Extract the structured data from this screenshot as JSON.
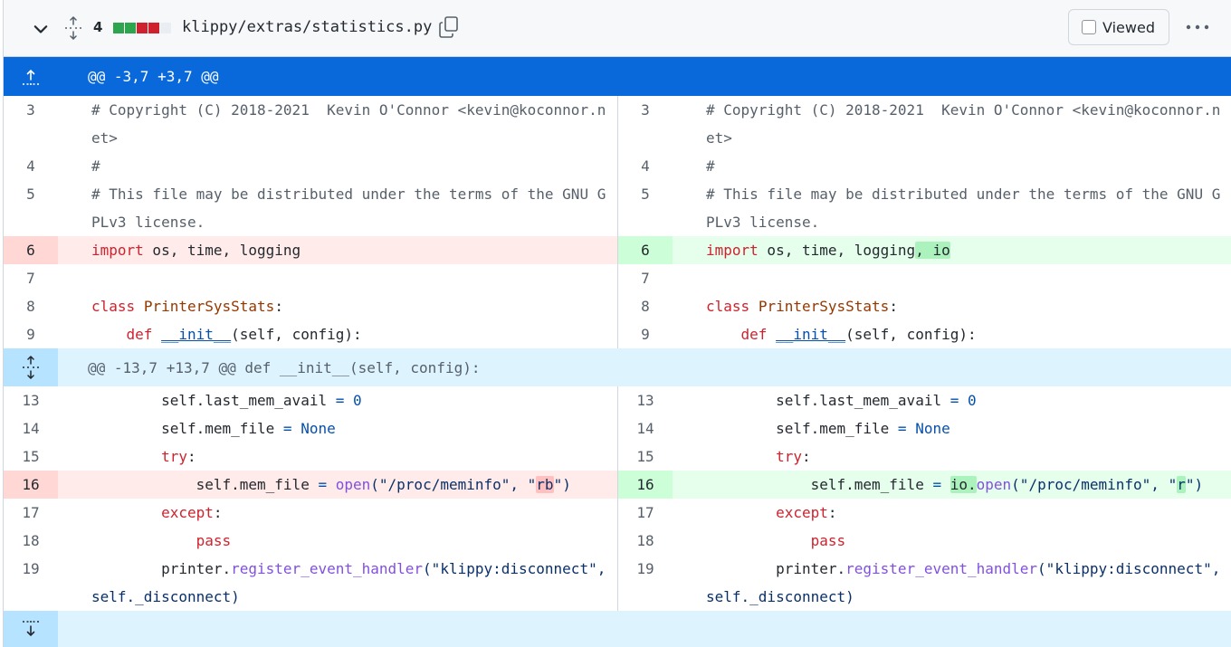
{
  "file": {
    "change_count": "4",
    "diffstat": [
      "#2da44e",
      "#2da44e",
      "#cf222e",
      "#cf222e",
      "#eaeef2"
    ],
    "filename": "klippy/extras/statistics.py",
    "viewed_label": "Viewed"
  },
  "hunks": [
    {
      "header": "@@ -3,7 +3,7 @@"
    },
    {
      "header": "@@ -13,7 +13,7 @@ def __init__(self, config):"
    }
  ],
  "lines": {
    "l3": {
      "num": "3",
      "text": "# Copyright (C) 2018-2021  Kevin O'Connor <kevin@koconnor.net>"
    },
    "l4": {
      "num": "4",
      "text": "#"
    },
    "l5": {
      "num": "5",
      "text": "# This file may be distributed under the terms of the GNU GPLv3 license."
    },
    "l6_old": {
      "num": "6",
      "kw": "import",
      "rest": " os, time, logging"
    },
    "l6_new": {
      "num": "6",
      "kw": "import",
      "rest": " os, time, logging",
      "added": ", io"
    },
    "l7": {
      "num": "7",
      "text": ""
    },
    "l8": {
      "num": "8",
      "kw": "class",
      "name": "PrinterSysStats",
      "rest": ":"
    },
    "l9": {
      "num": "9",
      "indent": "    ",
      "kw": "def",
      "name": "__init__",
      "rest": "(self, config):"
    },
    "l13": {
      "num": "13",
      "indent": "        ",
      "a": "self.last_mem_avail",
      "op": " = ",
      "val": "0"
    },
    "l14": {
      "num": "14",
      "indent": "        ",
      "a": "self.mem_file",
      "op": " = ",
      "val": "None"
    },
    "l15": {
      "num": "15",
      "indent": "        ",
      "kw": "try",
      "rest": ":"
    },
    "l16_old": {
      "num": "16",
      "indent": "            ",
      "a": "self.mem_file",
      "op": " = ",
      "fn": "open",
      "s1": "(\"/proc/meminfo\", \"",
      "hl": "rb",
      "s2": "\")"
    },
    "l16_new": {
      "num": "16",
      "indent": "            ",
      "a": "self.mem_file",
      "op": " = ",
      "hl": "io.",
      "fn": "open",
      "s1": "(\"/proc/meminfo\", \"",
      "hl2": "r",
      "s2": "\")"
    },
    "l17": {
      "num": "17",
      "indent": "        ",
      "kw": "except",
      "rest": ":"
    },
    "l18": {
      "num": "18",
      "indent": "            ",
      "kw": "pass"
    },
    "l19": {
      "num": "19",
      "indent": "        ",
      "a": "printer.",
      "fn": "register_event_handler",
      "rest": "(\"klippy:disconnect\", self._disconnect)"
    }
  }
}
